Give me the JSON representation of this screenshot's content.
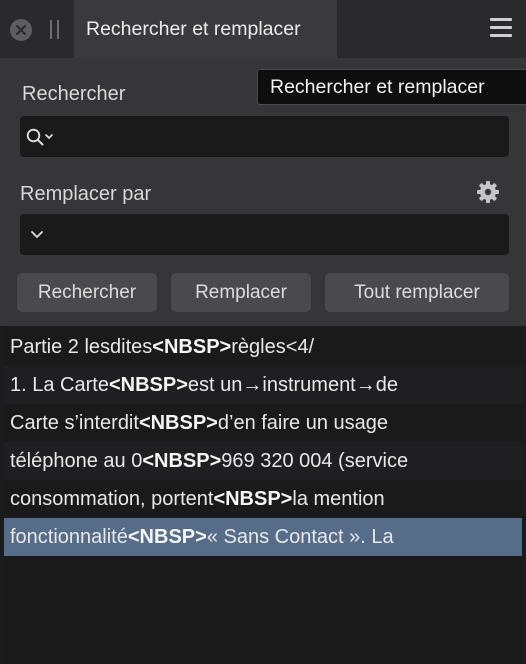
{
  "titlebar": {
    "tab_title": "Rechercher et remplacer"
  },
  "tooltip": {
    "text": "Rechercher et remplacer"
  },
  "find": {
    "label": "Rechercher",
    "value": "",
    "placeholder": ""
  },
  "replace": {
    "label": "Remplacer par",
    "value": "",
    "placeholder": ""
  },
  "buttons": {
    "find": "Rechercher",
    "replace": "Remplacer",
    "replace_all": "Tout remplacer"
  },
  "results": [
    {
      "before": "Partie 2 lesdites",
      "match": "<NBSP>",
      "after": "règles<4/"
    },
    {
      "before": "1. La Carte",
      "match": "<NBSP>",
      "after": "est un→instrument→de"
    },
    {
      "before": "Carte s’interdit",
      "match": "<NBSP>",
      "after": "d’en faire un usage"
    },
    {
      "before": "téléphone au 0",
      "match": "<NBSP>",
      "after": "969 320 004 (service"
    },
    {
      "before": "consommation, portent",
      "match": "<NBSP>",
      "after": "la mention"
    },
    {
      "before": "fonctionnalité",
      "match": "<NBSP>",
      "after": "« Sans Contact ». La"
    }
  ],
  "icons": {
    "close": "close-icon",
    "grip": "drag-handle-icon",
    "menu": "hamburger-menu-icon",
    "search": "search-icon",
    "dropdown": "chevron-down-icon",
    "settings": "gear-icon"
  },
  "colors": {
    "selection": "#566d8a",
    "panel": "#363638",
    "field": "#1a1a1b"
  }
}
